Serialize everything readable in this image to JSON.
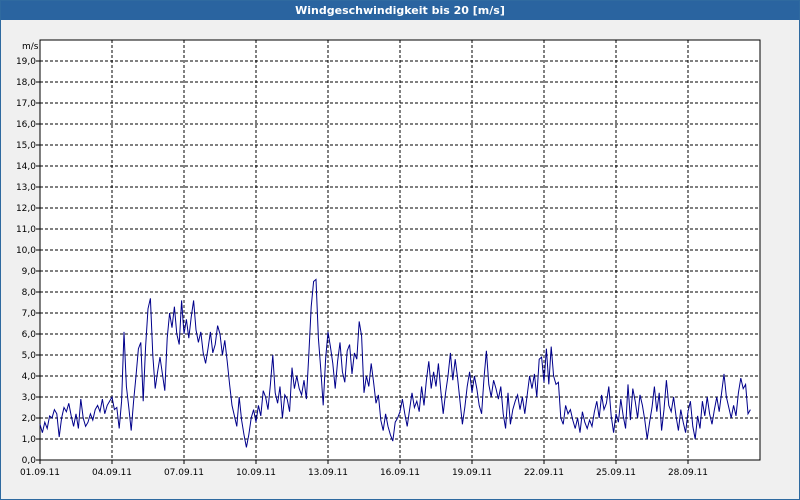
{
  "window": {
    "title": "Windgeschwindigkeit bis 20 [m/s]"
  },
  "chart_data": {
    "type": "line",
    "title": "Windgeschwindigkeit bis 20 [m/s]",
    "ylabel": "m/s",
    "xlabel": "",
    "ylim": [
      0,
      20
    ],
    "xlim": [
      0,
      30
    ],
    "grid": true,
    "line_color": "#00008b",
    "y_ticks": [
      "0,0",
      "1,0",
      "2,0",
      "3,0",
      "4,0",
      "5,0",
      "6,0",
      "7,0",
      "8,0",
      "9,0",
      "10,0",
      "11,0",
      "12,0",
      "13,0",
      "14,0",
      "15,0",
      "16,0",
      "17,0",
      "18,0",
      "19,0"
    ],
    "x_ticks": [
      {
        "x": 0,
        "label": "01.09.11"
      },
      {
        "x": 3,
        "label": "04.09.11"
      },
      {
        "x": 6,
        "label": "07.09.11"
      },
      {
        "x": 9,
        "label": "10.09.11"
      },
      {
        "x": 12,
        "label": "13.09.11"
      },
      {
        "x": 15,
        "label": "16.09.11"
      },
      {
        "x": 18,
        "label": "19.09.11"
      },
      {
        "x": 21,
        "label": "22.09.11"
      },
      {
        "x": 24,
        "label": "25.09.11"
      },
      {
        "x": 27,
        "label": "28.09.11"
      }
    ],
    "series": [
      {
        "values": [
          [
            0.0,
            1.7
          ],
          [
            0.1,
            1.3
          ],
          [
            0.2,
            1.8
          ],
          [
            0.3,
            1.5
          ],
          [
            0.4,
            2.1
          ],
          [
            0.5,
            2.0
          ],
          [
            0.6,
            2.4
          ],
          [
            0.7,
            2.2
          ],
          [
            0.8,
            1.1
          ],
          [
            0.9,
            2.0
          ],
          [
            1.0,
            2.5
          ],
          [
            1.1,
            2.3
          ],
          [
            1.2,
            2.7
          ],
          [
            1.3,
            2.1
          ],
          [
            1.4,
            1.6
          ],
          [
            1.5,
            2.2
          ],
          [
            1.6,
            1.5
          ],
          [
            1.7,
            2.9
          ],
          [
            1.8,
            2.0
          ],
          [
            1.9,
            1.6
          ],
          [
            2.0,
            1.8
          ],
          [
            2.1,
            2.2
          ],
          [
            2.2,
            1.9
          ],
          [
            2.3,
            2.4
          ],
          [
            2.4,
            2.6
          ],
          [
            2.5,
            2.3
          ],
          [
            2.6,
            2.9
          ],
          [
            2.7,
            2.2
          ],
          [
            2.8,
            2.6
          ],
          [
            2.9,
            2.8
          ],
          [
            3.0,
            3.0
          ],
          [
            3.1,
            2.4
          ],
          [
            3.2,
            2.5
          ],
          [
            3.3,
            1.5
          ],
          [
            3.4,
            2.8
          ],
          [
            3.5,
            6.1
          ],
          [
            3.6,
            3.5
          ],
          [
            3.7,
            2.5
          ],
          [
            3.8,
            1.4
          ],
          [
            3.9,
            2.8
          ],
          [
            4.0,
            4.0
          ],
          [
            4.1,
            5.3
          ],
          [
            4.2,
            5.6
          ],
          [
            4.3,
            2.8
          ],
          [
            4.4,
            5.4
          ],
          [
            4.5,
            7.2
          ],
          [
            4.6,
            7.7
          ],
          [
            4.7,
            5.0
          ],
          [
            4.8,
            3.4
          ],
          [
            4.9,
            4.2
          ],
          [
            5.0,
            4.9
          ],
          [
            5.1,
            4.1
          ],
          [
            5.2,
            3.3
          ],
          [
            5.3,
            5.8
          ],
          [
            5.4,
            7.0
          ],
          [
            5.5,
            6.3
          ],
          [
            5.6,
            7.3
          ],
          [
            5.7,
            6.0
          ],
          [
            5.8,
            5.5
          ],
          [
            5.9,
            7.6
          ],
          [
            6.0,
            6.0
          ],
          [
            6.1,
            6.7
          ],
          [
            6.2,
            5.8
          ],
          [
            6.3,
            6.8
          ],
          [
            6.4,
            7.6
          ],
          [
            6.5,
            6.2
          ],
          [
            6.6,
            5.6
          ],
          [
            6.7,
            6.1
          ],
          [
            6.8,
            5.1
          ],
          [
            6.9,
            4.6
          ],
          [
            7.0,
            5.3
          ],
          [
            7.1,
            6.1
          ],
          [
            7.2,
            5.1
          ],
          [
            7.3,
            5.5
          ],
          [
            7.4,
            6.4
          ],
          [
            7.5,
            6.0
          ],
          [
            7.6,
            5.0
          ],
          [
            7.7,
            5.7
          ],
          [
            7.8,
            4.7
          ],
          [
            7.9,
            3.6
          ],
          [
            8.0,
            2.6
          ],
          [
            8.1,
            2.1
          ],
          [
            8.2,
            1.6
          ],
          [
            8.3,
            3.0
          ],
          [
            8.4,
            1.9
          ],
          [
            8.5,
            1.2
          ],
          [
            8.6,
            0.6
          ],
          [
            8.7,
            1.2
          ],
          [
            8.8,
            2.0
          ],
          [
            8.9,
            2.4
          ],
          [
            9.0,
            1.8
          ],
          [
            9.1,
            2.6
          ],
          [
            9.2,
            2.1
          ],
          [
            9.3,
            3.3
          ],
          [
            9.4,
            3.0
          ],
          [
            9.5,
            2.4
          ],
          [
            9.6,
            3.6
          ],
          [
            9.7,
            5.0
          ],
          [
            9.8,
            3.2
          ],
          [
            9.9,
            2.7
          ],
          [
            10.0,
            3.5
          ],
          [
            10.1,
            2.0
          ],
          [
            10.2,
            3.1
          ],
          [
            10.3,
            2.9
          ],
          [
            10.4,
            2.3
          ],
          [
            10.5,
            4.4
          ],
          [
            10.6,
            3.4
          ],
          [
            10.7,
            4.0
          ],
          [
            10.8,
            3.4
          ],
          [
            10.9,
            3.1
          ],
          [
            11.0,
            3.8
          ],
          [
            11.1,
            2.9
          ],
          [
            11.2,
            5.0
          ],
          [
            11.3,
            7.3
          ],
          [
            11.4,
            8.5
          ],
          [
            11.5,
            8.6
          ],
          [
            11.6,
            5.8
          ],
          [
            11.7,
            4.3
          ],
          [
            11.8,
            2.6
          ],
          [
            11.9,
            4.8
          ],
          [
            12.0,
            6.1
          ],
          [
            12.1,
            5.4
          ],
          [
            12.2,
            4.6
          ],
          [
            12.3,
            3.4
          ],
          [
            12.4,
            4.7
          ],
          [
            12.5,
            5.6
          ],
          [
            12.6,
            4.2
          ],
          [
            12.7,
            3.7
          ],
          [
            12.8,
            5.2
          ],
          [
            12.9,
            5.5
          ],
          [
            13.0,
            4.1
          ],
          [
            13.1,
            5.1
          ],
          [
            13.2,
            4.8
          ],
          [
            13.3,
            6.6
          ],
          [
            13.4,
            5.9
          ],
          [
            13.5,
            3.2
          ],
          [
            13.6,
            4.0
          ],
          [
            13.7,
            3.5
          ],
          [
            13.8,
            4.6
          ],
          [
            13.9,
            3.7
          ],
          [
            14.0,
            2.7
          ],
          [
            14.1,
            3.1
          ],
          [
            14.2,
            1.9
          ],
          [
            14.3,
            1.4
          ],
          [
            14.4,
            2.2
          ],
          [
            14.5,
            1.6
          ],
          [
            14.6,
            1.2
          ],
          [
            14.7,
            0.9
          ],
          [
            14.8,
            1.8
          ],
          [
            14.9,
            2.0
          ],
          [
            15.0,
            2.3
          ],
          [
            15.1,
            2.9
          ],
          [
            15.2,
            2.2
          ],
          [
            15.3,
            1.6
          ],
          [
            15.4,
            2.4
          ],
          [
            15.5,
            3.2
          ],
          [
            15.6,
            2.5
          ],
          [
            15.7,
            2.8
          ],
          [
            15.8,
            2.3
          ],
          [
            15.9,
            3.5
          ],
          [
            16.0,
            2.6
          ],
          [
            16.1,
            3.8
          ],
          [
            16.2,
            4.7
          ],
          [
            16.3,
            3.4
          ],
          [
            16.4,
            4.2
          ],
          [
            16.5,
            3.5
          ],
          [
            16.6,
            4.6
          ],
          [
            16.7,
            3.3
          ],
          [
            16.8,
            2.2
          ],
          [
            16.9,
            3.2
          ],
          [
            17.0,
            4.0
          ],
          [
            17.1,
            5.1
          ],
          [
            17.2,
            3.8
          ],
          [
            17.3,
            4.8
          ],
          [
            17.4,
            3.9
          ],
          [
            17.5,
            2.8
          ],
          [
            17.6,
            1.7
          ],
          [
            17.7,
            2.5
          ],
          [
            17.8,
            3.5
          ],
          [
            17.9,
            4.2
          ],
          [
            18.0,
            3.2
          ],
          [
            18.1,
            4.0
          ],
          [
            18.2,
            3.4
          ],
          [
            18.3,
            2.6
          ],
          [
            18.4,
            2.2
          ],
          [
            18.5,
            3.9
          ],
          [
            18.6,
            5.2
          ],
          [
            18.7,
            3.6
          ],
          [
            18.8,
            3.0
          ],
          [
            18.9,
            3.8
          ],
          [
            19.0,
            3.4
          ],
          [
            19.1,
            2.9
          ],
          [
            19.2,
            3.5
          ],
          [
            19.3,
            2.2
          ],
          [
            19.4,
            1.5
          ],
          [
            19.5,
            3.2
          ],
          [
            19.6,
            1.7
          ],
          [
            19.7,
            2.4
          ],
          [
            19.8,
            2.8
          ],
          [
            19.9,
            3.1
          ],
          [
            20.0,
            2.4
          ],
          [
            20.1,
            3.0
          ],
          [
            20.2,
            2.2
          ],
          [
            20.3,
            3.1
          ],
          [
            20.4,
            4.0
          ],
          [
            20.5,
            3.4
          ],
          [
            20.6,
            4.1
          ],
          [
            20.7,
            3.0
          ],
          [
            20.8,
            4.8
          ],
          [
            20.9,
            4.9
          ],
          [
            21.0,
            3.7
          ],
          [
            21.1,
            5.3
          ],
          [
            21.2,
            3.6
          ],
          [
            21.3,
            5.4
          ],
          [
            21.4,
            4.0
          ],
          [
            21.5,
            3.6
          ],
          [
            21.6,
            3.7
          ],
          [
            21.7,
            2.0
          ],
          [
            21.8,
            1.7
          ],
          [
            21.9,
            2.6
          ],
          [
            22.0,
            2.2
          ],
          [
            22.1,
            2.4
          ],
          [
            22.2,
            1.9
          ],
          [
            22.3,
            1.5
          ],
          [
            22.4,
            2.0
          ],
          [
            22.5,
            1.3
          ],
          [
            22.6,
            2.3
          ],
          [
            22.7,
            1.8
          ],
          [
            22.8,
            1.5
          ],
          [
            22.9,
            1.9
          ],
          [
            23.0,
            1.6
          ],
          [
            23.1,
            2.3
          ],
          [
            23.2,
            2.8
          ],
          [
            23.3,
            2.0
          ],
          [
            23.4,
            3.1
          ],
          [
            23.5,
            2.4
          ],
          [
            23.6,
            2.7
          ],
          [
            23.7,
            3.5
          ],
          [
            23.8,
            2.1
          ],
          [
            23.9,
            1.3
          ],
          [
            24.0,
            2.2
          ],
          [
            24.1,
            1.8
          ],
          [
            24.2,
            2.9
          ],
          [
            24.3,
            2.1
          ],
          [
            24.4,
            1.5
          ],
          [
            24.5,
            3.6
          ],
          [
            24.6,
            1.9
          ],
          [
            24.7,
            3.4
          ],
          [
            24.8,
            2.8
          ],
          [
            24.9,
            2.0
          ],
          [
            25.0,
            3.1
          ],
          [
            25.1,
            2.6
          ],
          [
            25.2,
            1.9
          ],
          [
            25.3,
            1.0
          ],
          [
            25.4,
            1.8
          ],
          [
            25.5,
            2.5
          ],
          [
            25.6,
            3.5
          ],
          [
            25.7,
            2.3
          ],
          [
            25.8,
            3.2
          ],
          [
            25.9,
            1.4
          ],
          [
            26.0,
            2.4
          ],
          [
            26.1,
            3.8
          ],
          [
            26.2,
            2.6
          ],
          [
            26.3,
            2.3
          ],
          [
            26.4,
            3.0
          ],
          [
            26.5,
            2.1
          ],
          [
            26.6,
            1.4
          ],
          [
            26.7,
            2.4
          ],
          [
            26.8,
            1.8
          ],
          [
            26.9,
            1.3
          ],
          [
            27.0,
            2.3
          ],
          [
            27.1,
            2.8
          ],
          [
            27.2,
            1.6
          ],
          [
            27.3,
            1.0
          ],
          [
            27.4,
            2.1
          ],
          [
            27.5,
            1.5
          ],
          [
            27.6,
            2.8
          ],
          [
            27.7,
            2.1
          ],
          [
            27.8,
            3.0
          ],
          [
            27.9,
            2.2
          ],
          [
            28.0,
            1.7
          ],
          [
            28.1,
            2.4
          ],
          [
            28.2,
            3.0
          ],
          [
            28.3,
            2.3
          ],
          [
            28.4,
            3.2
          ],
          [
            28.5,
            4.1
          ],
          [
            28.6,
            3.0
          ],
          [
            28.7,
            2.5
          ],
          [
            28.8,
            2.0
          ],
          [
            28.9,
            2.6
          ],
          [
            29.0,
            2.1
          ],
          [
            29.1,
            3.2
          ],
          [
            29.2,
            3.9
          ],
          [
            29.3,
            3.4
          ],
          [
            29.4,
            3.6
          ],
          [
            29.5,
            2.2
          ],
          [
            29.6,
            2.4
          ]
        ]
      }
    ]
  }
}
